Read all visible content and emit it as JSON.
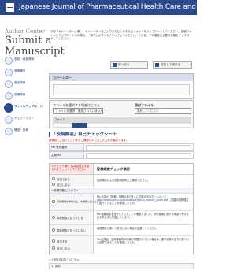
{
  "header": {
    "journal_title": "Japanese Journal of Pharmaceutical Health Care and Sciences"
  },
  "brand": {
    "line1": "Author Center",
    "line2": "Submit a",
    "line3": "Manuscript"
  },
  "steps": [
    {
      "label": "表紙・著者情報"
    },
    {
      "label": "原稿種別"
    },
    {
      "label": "著者情報"
    },
    {
      "label": "原稿情報"
    },
    {
      "label": "ファイルアップロード"
    },
    {
      "label": "チェックリスト"
    },
    {
      "label": "確認・投稿"
    }
  ],
  "intro_text": "下記「カバーレター」欄に、カバーレターをご入力いただくかまたはファイルをアップロードしてください。投稿ファイルをアップロードした場合、「添付」ボタンをクリックしてください。その後、下の審査に必要な書類をアップロードしてください。",
  "top_buttons": {
    "prev": "前へ戻る",
    "next": "保存して続ける"
  },
  "cover_letter": {
    "heading": "カバーレター"
  },
  "upload": {
    "file_label": "ファイルを選択する場合はこちら",
    "choose_file": "ファイルを選択　選択されていません",
    "type_label": "添付ファイル",
    "type_value": "選択してください",
    "table_header": "ファイル"
  },
  "checklist": {
    "title": "「投稿要項」自己チェックシート",
    "warning": "投稿前にご覧ください必ずご確認いただきご入力をお願いします。",
    "fields": [
      {
        "label": "Ms 管理番号"
      },
      {
        "label": "主題Ms"
      }
    ],
    "table": {
      "left_head": "＜チェック欄＞\n各項目該当するものをチェックしてください",
      "right_head": "投稿規定チェック項目",
      "row1_opts": [
        "該当である",
        "該当しない"
      ],
      "row1_desc": "投稿規定および投稿規程等をご確認ください。",
      "sub1": "<倫理規範について>",
      "row2_opt": "投稿規程を参照の上、本規程に従っている",
      "row2_desc": "Ms 本誌の「投稿・投稿の手引き」に記載の当会ホームページ",
      "row2_link": "http://www.jsphcs.jp/journal/pdf/jjphcs_submit_guide.pdf",
      "row2_desc2": "に掲載の投稿規定に従っていることを確認しました。",
      "row3_opt": "準拠規程に従っている",
      "row3_desc": "Ms 倫理規定を遵守していることを確認しました。研究倫理に関する承認を受けた旨を本文中に記載しています。",
      "row4_opt": "準拠規程に従っていない",
      "row4_desc": "倫理規定に関して該当しない理由を記載してください。",
      "row5_opts": [
        "該当する",
        "該当しない"
      ],
      "row5_desc": "Ms 医薬品・医療機器等の情報が掲載されている場合は、薬事法等の法令に基づいた記載であることを確認しました。"
    },
    "reason_head": "<上記の対応について>",
    "reason_row": "1. 名称"
  }
}
